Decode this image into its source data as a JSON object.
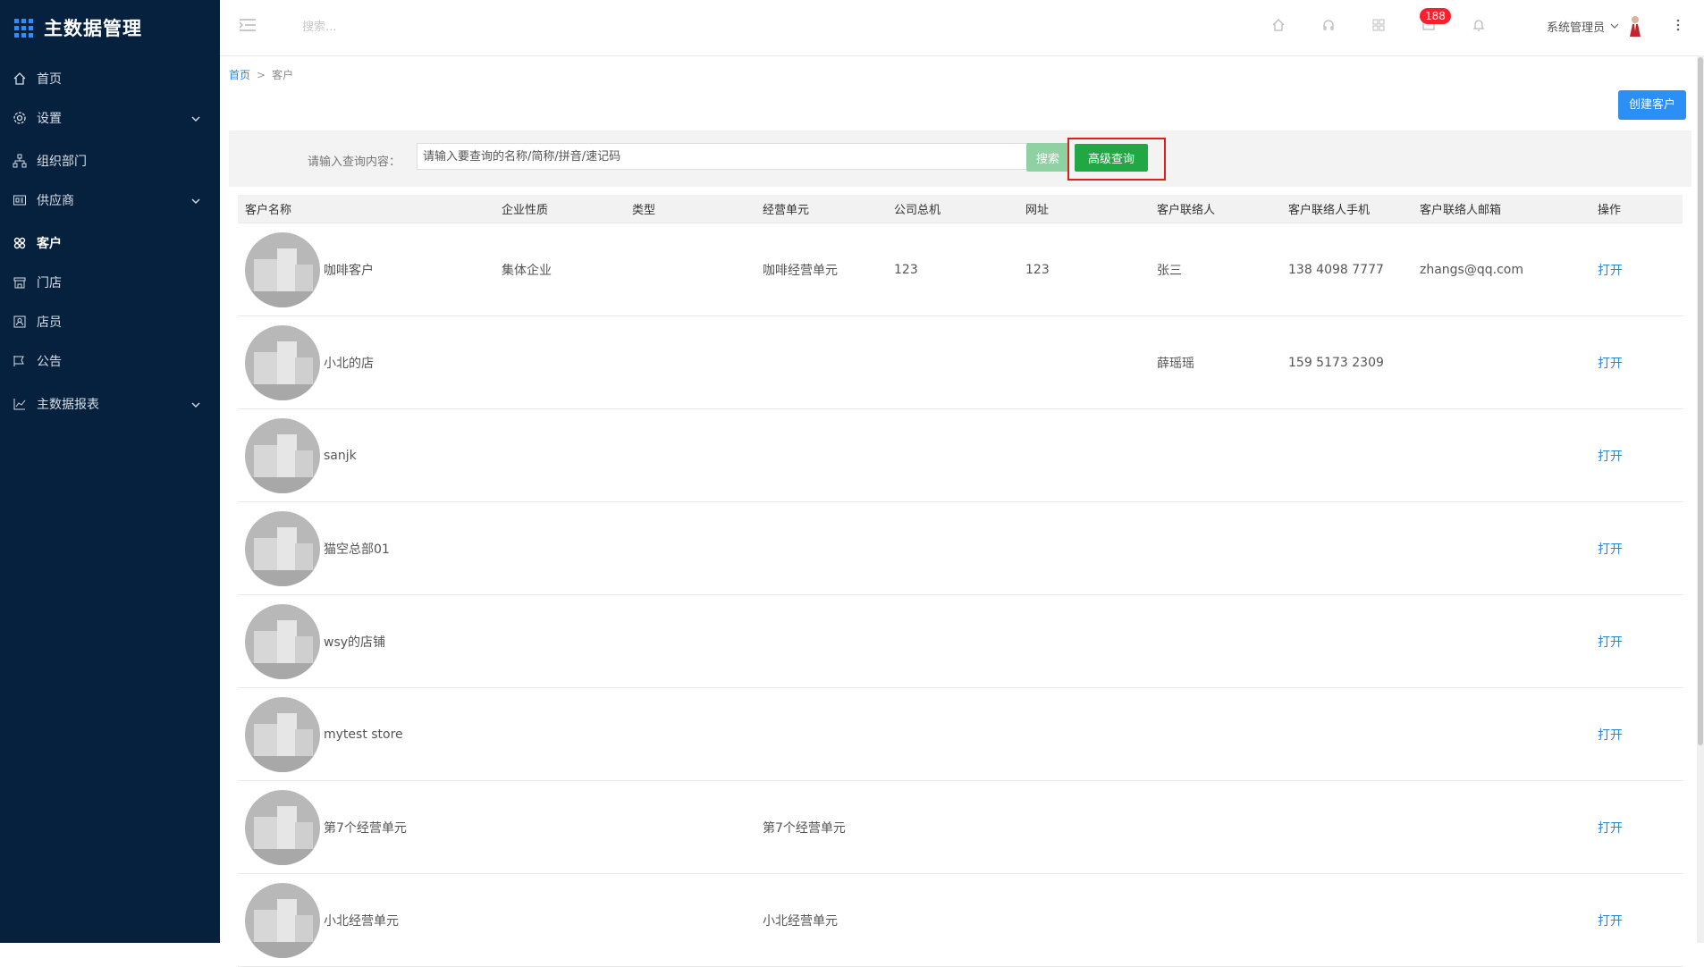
{
  "app": {
    "title": "主数据管理"
  },
  "sidebar": {
    "items": [
      {
        "label": "首页",
        "icon": "home-icon"
      },
      {
        "label": "设置",
        "icon": "gear-icon",
        "expandable": true
      },
      {
        "label": "组织部门",
        "icon": "org-icon"
      },
      {
        "label": "供应商",
        "icon": "supplier-icon",
        "expandable": true
      },
      {
        "label": "客户",
        "icon": "customer-icon",
        "active": true
      },
      {
        "label": "门店",
        "icon": "store-icon"
      },
      {
        "label": "店员",
        "icon": "staff-icon"
      },
      {
        "label": "公告",
        "icon": "notice-icon"
      },
      {
        "label": "主数据报表",
        "icon": "chart-icon",
        "expandable": true
      }
    ]
  },
  "header": {
    "search_placeholder": "搜索...",
    "badge_count": "188",
    "user_name": "系统管理员"
  },
  "breadcrumb": {
    "home": "首页",
    "separator": ">",
    "current": "客户"
  },
  "toolbar": {
    "create_label": "创建客户"
  },
  "search": {
    "label": "请输入查询内容：",
    "placeholder": "请输入要查询的名称/简称/拼音/速记码",
    "search_label": "搜索",
    "advanced_label": "高级查询"
  },
  "table": {
    "headers": [
      "客户名称",
      "企业性质",
      "类型",
      "经营单元",
      "公司总机",
      "网址",
      "客户联络人",
      "客户联络人手机",
      "客户联络人邮箱",
      "操作"
    ],
    "rows": [
      {
        "name": "咖啡客户",
        "nature": "集体企业",
        "type": "",
        "unit": "咖啡经营单元",
        "phone": "123",
        "site": "123",
        "contact": "张三",
        "mobile": "138 4098 7777",
        "email": "zhangs@qq.com",
        "action": "打开"
      },
      {
        "name": "小北的店",
        "nature": "",
        "type": "",
        "unit": "",
        "phone": "",
        "site": "",
        "contact": "薛瑶瑶",
        "mobile": "159 5173 2309",
        "email": "",
        "action": "打开"
      },
      {
        "name": "sanjk",
        "nature": "",
        "type": "",
        "unit": "",
        "phone": "",
        "site": "",
        "contact": "",
        "mobile": "",
        "email": "",
        "action": "打开"
      },
      {
        "name": "猫空总部01",
        "nature": "",
        "type": "",
        "unit": "",
        "phone": "",
        "site": "",
        "contact": "",
        "mobile": "",
        "email": "",
        "action": "打开"
      },
      {
        "name": "wsy的店铺",
        "nature": "",
        "type": "",
        "unit": "",
        "phone": "",
        "site": "",
        "contact": "",
        "mobile": "",
        "email": "",
        "action": "打开"
      },
      {
        "name": "mytest store",
        "nature": "",
        "type": "",
        "unit": "",
        "phone": "",
        "site": "",
        "contact": "",
        "mobile": "",
        "email": "",
        "action": "打开"
      },
      {
        "name": "第7个经营单元",
        "nature": "",
        "type": "",
        "unit": "第7个经营单元",
        "phone": "",
        "site": "",
        "contact": "",
        "mobile": "",
        "email": "",
        "action": "打开"
      },
      {
        "name": "小北经营单元",
        "nature": "",
        "type": "",
        "unit": "小北经营单元",
        "phone": "",
        "site": "",
        "contact": "",
        "mobile": "",
        "email": "",
        "action": "打开"
      }
    ]
  },
  "colors": {
    "sidebar_bg": "#06213d",
    "accent": "#2b8ff5",
    "advanced_btn": "#22a745",
    "highlight_border": "#e21b1b",
    "badge": "#f5222d"
  }
}
